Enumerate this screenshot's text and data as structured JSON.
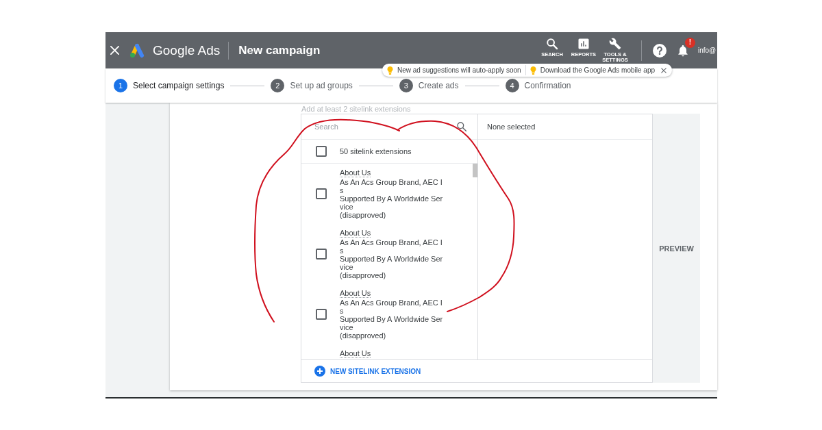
{
  "header": {
    "product": "Google Ads",
    "title": "New campaign",
    "tools": [
      {
        "kind": "search",
        "label": "SEARCH"
      },
      {
        "kind": "reports",
        "label": "REPORTS"
      },
      {
        "kind": "tools",
        "label": "TOOLS & SETTINGS"
      }
    ],
    "alert_badge": "!",
    "account": "info@"
  },
  "notices": [
    {
      "text": "New ad suggestions will auto-apply soon"
    },
    {
      "text": "Download the Google Ads mobile app"
    }
  ],
  "steps": [
    {
      "number": "1",
      "label": "Select campaign settings",
      "selected": true
    },
    {
      "number": "2",
      "label": "Set up ad groups",
      "selected": false
    },
    {
      "number": "3",
      "label": "Create ads",
      "selected": false
    },
    {
      "number": "4",
      "label": "Confirmation",
      "selected": false
    }
  ],
  "sitelinks": {
    "hint": "Add at least 2 sitelink extensions",
    "search": {
      "placeholder": "Search"
    },
    "select_all": {
      "label": "50 sitelink extensions",
      "checked": false
    },
    "items": [
      {
        "title": "About Us",
        "lines": [
          "As An Acs Group Brand, AEC I",
          "s",
          "Supported By A Worldwide Ser",
          "vice"
        ],
        "status": "(disapproved)",
        "checked": false
      },
      {
        "title": "About Us",
        "lines": [
          "As An Acs Group Brand, AEC I",
          "s",
          "Supported By A Worldwide Ser",
          "vice"
        ],
        "status": "(disapproved)",
        "checked": false
      },
      {
        "title": "About Us",
        "lines": [
          "As An Acs Group Brand, AEC I",
          "s",
          "Supported By A Worldwide Ser",
          "vice"
        ],
        "status": "(disapproved)",
        "checked": false
      },
      {
        "title": "About Us"
      }
    ],
    "selected_header": "None selected",
    "new_button": "NEW SITELINK EXTENSION",
    "preview": "PREVIEW"
  }
}
